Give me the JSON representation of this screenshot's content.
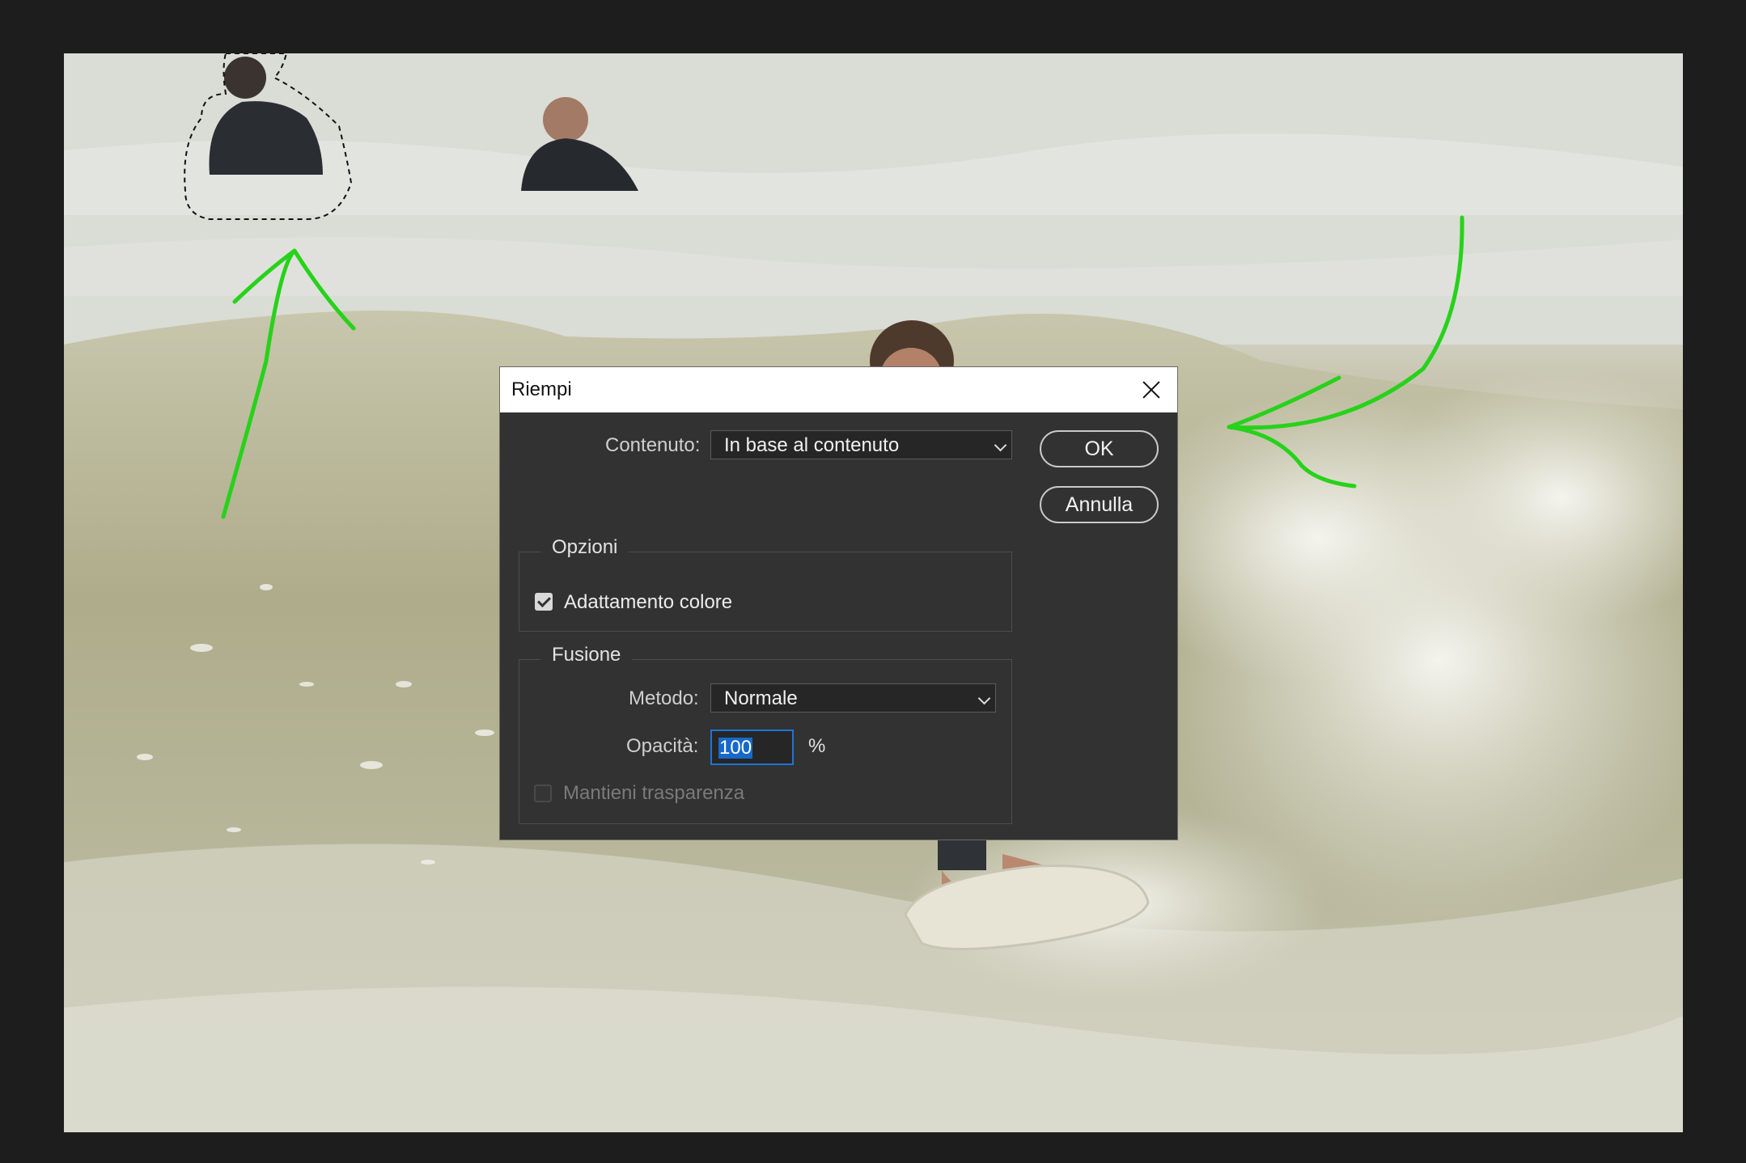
{
  "dialog": {
    "title": "Riempi",
    "content_label": "Contenuto:",
    "content_value": "In base al contenuto",
    "ok_label": "OK",
    "cancel_label": "Annulla",
    "options_legend": "Opzioni",
    "color_adapt_label": "Adattamento colore",
    "color_adapt_checked": true,
    "blend_legend": "Fusione",
    "method_label": "Metodo:",
    "method_value": "Normale",
    "opacity_label": "Opacità:",
    "opacity_value": "100",
    "opacity_unit": "%",
    "preserve_label": "Mantieni trasparenza",
    "preserve_checked": false,
    "preserve_disabled": true
  },
  "colors": {
    "annotation": "#27d21a",
    "selection": "#111111",
    "input_focus": "#1f73d6"
  },
  "icons": [
    "close-icon",
    "chevron-down-icon",
    "checkmark-icon"
  ]
}
